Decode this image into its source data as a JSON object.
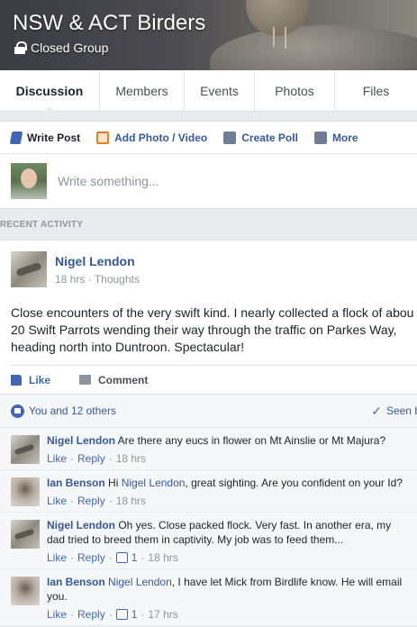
{
  "group": {
    "name": "NSW & ACT Birders",
    "privacy": "Closed Group"
  },
  "tabs": [
    {
      "label": "Discussion"
    },
    {
      "label": "Members"
    },
    {
      "label": "Events"
    },
    {
      "label": "Photos"
    },
    {
      "label": "Files"
    }
  ],
  "composer": {
    "write_post": "Write Post",
    "add_photo": "Add Photo / Video",
    "create_poll": "Create Poll",
    "more": "More",
    "placeholder": "Write something..."
  },
  "section_label": "RECENT ACTIVITY",
  "post": {
    "author": "Nigel Lendon",
    "time": "18 hrs",
    "privacy": "Thoughts",
    "body_lines": [
      "Close encounters of the very swift kind. I nearly collected a flock of abou",
      "20 Swift Parrots wending their way through the traffic on Parkes Way,",
      "heading north into Duntroon. Spectacular!"
    ],
    "like_label": "Like",
    "comment_label": "Comment",
    "likes_text": "You and 12 others",
    "seen_text": "Seen by"
  },
  "comments": [
    {
      "author": "Nigel Lendon",
      "mention": "",
      "text": "Are there any eucs in flower on Mt Ainslie or Mt Majura?",
      "like": "Like",
      "reply": "Reply",
      "likes_count": "",
      "time": "18 hrs"
    },
    {
      "author": "Ian Benson",
      "mention": "Nigel Lendon",
      "pre_text": "Hi",
      "text": ", great sighting. Are you confident on your Id?",
      "like": "Like",
      "reply": "Reply",
      "likes_count": "",
      "time": "18 hrs"
    },
    {
      "author": "Nigel Lendon",
      "mention": "",
      "text": "Oh yes. Close packed flock. Very fast. In another era, my dad tried to breed them in captivity. My job was to feed them...",
      "like": "Like",
      "reply": "Reply",
      "likes_count": "1",
      "time": "18 hrs"
    },
    {
      "author": "Ian Benson",
      "mention": "Nigel Lendon",
      "pre_text": "",
      "text": ", I have let Mick from Birdlife know. He will email you.",
      "like": "Like",
      "reply": "Reply",
      "likes_count": "1",
      "time": "17 hrs"
    }
  ],
  "colors": {
    "link": "#365899",
    "accent": "#4267b2",
    "muted": "#90949c"
  }
}
